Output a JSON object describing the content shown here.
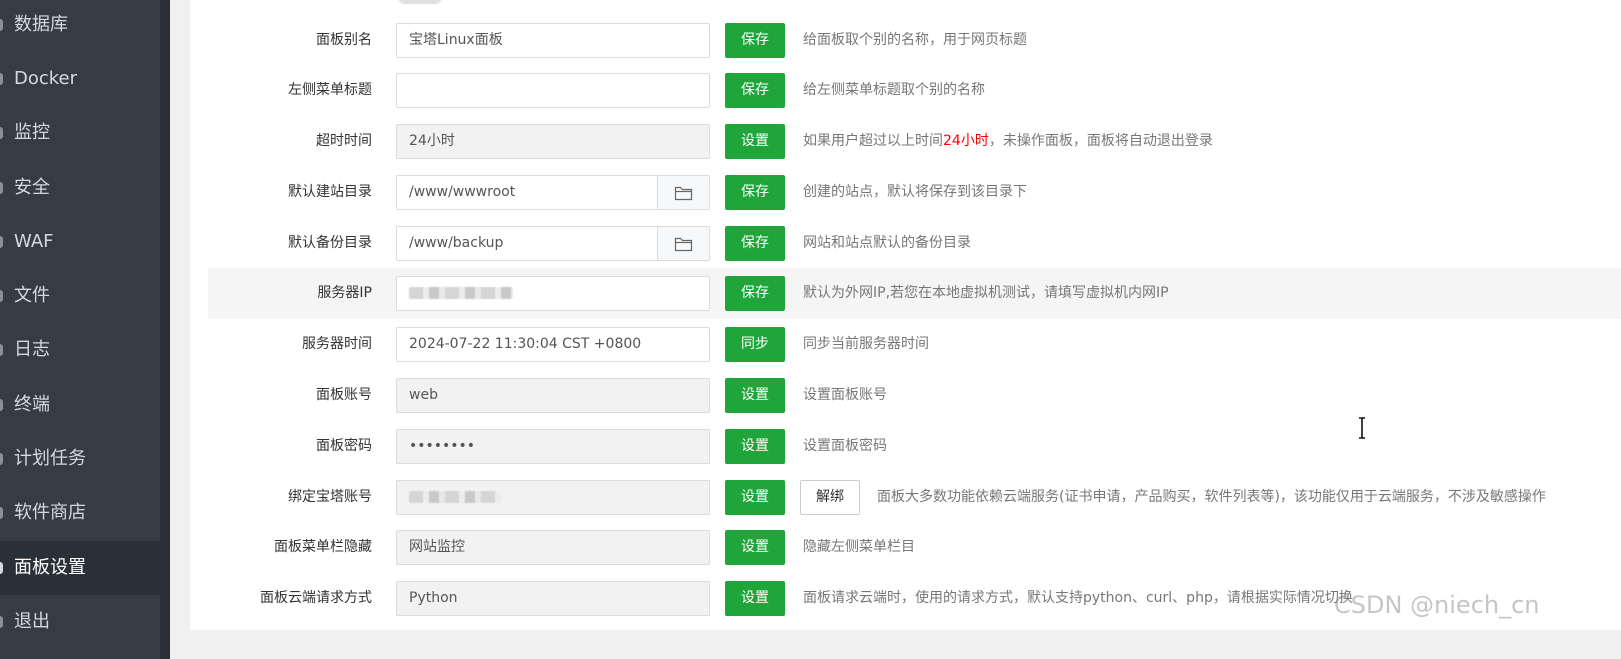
{
  "sidebar": {
    "items": [
      {
        "label": "数据库"
      },
      {
        "label": "Docker"
      },
      {
        "label": "监控"
      },
      {
        "label": "安全"
      },
      {
        "label": "WAF"
      },
      {
        "label": "文件"
      },
      {
        "label": "日志"
      },
      {
        "label": "终端"
      },
      {
        "label": "计划任务"
      },
      {
        "label": "软件商店"
      },
      {
        "label": "面板设置"
      },
      {
        "label": "退出"
      }
    ],
    "active": "面板设置"
  },
  "settings": {
    "rows": [
      {
        "label": "面板别名",
        "value": "宝塔Linux面板",
        "button": "保存",
        "desc": "给面板取个别的名称，用于网页标题"
      },
      {
        "label": "左侧菜单标题",
        "value": "",
        "button": "保存",
        "desc": "给左侧菜单标题取个别的名称"
      },
      {
        "label": "超时时间",
        "value": "24小时",
        "button": "设置",
        "desc_pre": "如果用户超过以上时间",
        "desc_highlight": "24小时",
        "desc_post": "，未操作面板，面板将自动退出登录"
      },
      {
        "label": "默认建站目录",
        "value": "/www/wwwroot",
        "button": "保存",
        "desc": "创建的站点，默认将保存到该目录下"
      },
      {
        "label": "默认备份目录",
        "value": "/www/backup",
        "button": "保存",
        "desc": "网站和站点默认的备份目录"
      },
      {
        "label": "服务器IP",
        "value": "",
        "button": "保存",
        "desc": "默认为外网IP,若您在本地虚拟机测试，请填写虚拟机内网IP"
      },
      {
        "label": "服务器时间",
        "value": "2024-07-22 11:30:04 CST +0800",
        "button": "同步",
        "desc": "同步当前服务器时间"
      },
      {
        "label": "面板账号",
        "value": "web",
        "button": "设置",
        "desc": "设置面板账号"
      },
      {
        "label": "面板密码",
        "value": "••••••••",
        "button": "设置",
        "desc": "设置面板密码"
      },
      {
        "label": "绑定宝塔账号",
        "value": "",
        "button": "设置",
        "secondary_button": "解绑",
        "desc": "面板大多数功能依赖云端服务(证书申请，产品购买，软件列表等)，该功能仅用于云端服务，不涉及敏感操作"
      },
      {
        "label": "面板菜单栏隐藏",
        "value": "网站监控",
        "button": "设置",
        "desc": "隐藏左侧菜单栏目"
      },
      {
        "label": "面板云端请求方式",
        "value": "Python",
        "button": "设置",
        "desc": "面板请求云端时，使用的请求方式，默认支持python、curl、php，请根据实际情况切换"
      }
    ]
  },
  "watermark": "CSDN @niech_cn",
  "colors": {
    "sidebar_bg": "#353c44",
    "accent_green": "#20a53a",
    "highlight_red": "#ff0000"
  }
}
